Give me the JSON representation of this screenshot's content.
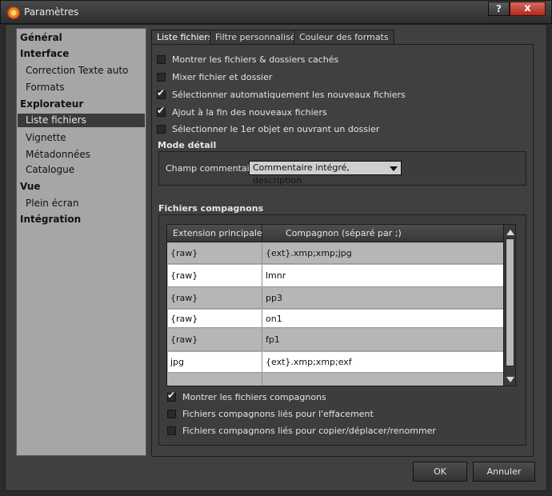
{
  "window": {
    "title": "Paramètres",
    "help_label": "?",
    "close_label": "x"
  },
  "sidebar": {
    "items": [
      {
        "label": "Général",
        "level": "top"
      },
      {
        "label": "Interface",
        "level": "top"
      },
      {
        "label": "Correction Texte auto",
        "level": "sub"
      },
      {
        "label": "Formats",
        "level": "sub"
      },
      {
        "label": "Explorateur",
        "level": "top"
      },
      {
        "label": "Liste fichiers",
        "level": "sub",
        "selected": true
      },
      {
        "label": "Vignette",
        "level": "sub"
      },
      {
        "label": "Métadonnées",
        "level": "sub"
      },
      {
        "label": "Catalogue",
        "level": "sub"
      },
      {
        "label": "Vue",
        "level": "top"
      },
      {
        "label": "Plein écran",
        "level": "sub"
      },
      {
        "label": "Intégration",
        "level": "top"
      }
    ]
  },
  "tabs": [
    {
      "label": "Liste fichiers",
      "active": true
    },
    {
      "label": "Filtre personnalisé",
      "active": false
    },
    {
      "label": "Couleur des formats",
      "active": false
    }
  ],
  "options": [
    {
      "label": "Montrer les fichiers & dossiers cachés",
      "checked": false
    },
    {
      "label": "Mixer fichier et dossier",
      "checked": false
    },
    {
      "label": "Sélectionner automatiquement les nouveaux fichiers",
      "checked": true
    },
    {
      "label": "Ajout à la fin des nouveaux fichiers",
      "checked": true
    },
    {
      "label": "Sélectionner le 1er objet en ouvrant un dossier",
      "checked": false
    }
  ],
  "detail_mode": {
    "title": "Mode détail",
    "comment_label": "Champ commentaire",
    "comment_value": "Commentaire intégré, description"
  },
  "companions": {
    "title": "Fichiers compagnons",
    "columns": [
      "Extension principale",
      "Compagnon (séparé par ;)"
    ],
    "rows": [
      [
        "{raw}",
        "{ext}.xmp;xmp;jpg"
      ],
      [
        "{raw}",
        "lmnr"
      ],
      [
        "{raw}",
        "pp3"
      ],
      [
        "{raw}",
        "on1"
      ],
      [
        "{raw}",
        "fp1"
      ],
      [
        "jpg",
        "{ext}.xmp;xmp;exf"
      ],
      [
        "",
        ""
      ]
    ],
    "options": [
      {
        "label": "Montrer les fichiers compagnons",
        "checked": true
      },
      {
        "label": "Fichiers compagnons liés pour l'effacement",
        "checked": false
      },
      {
        "label": "Fichiers compagnons liés pour copier/déplacer/renommer",
        "checked": false
      }
    ]
  },
  "buttons": {
    "ok": "OK",
    "cancel": "Annuler"
  }
}
